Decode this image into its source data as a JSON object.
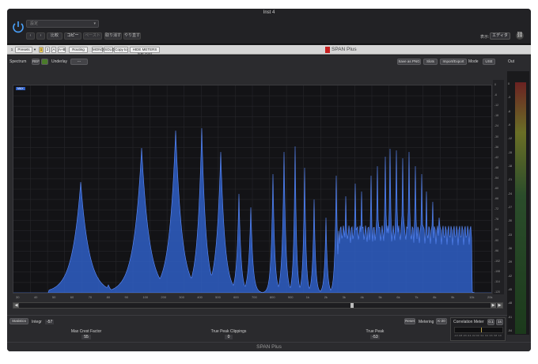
{
  "host": {
    "title": "Inst 4",
    "preset_placeholder": "設定",
    "buttons": [
      "比較",
      "コピー",
      "ペースト",
      "取り消す",
      "やり直す"
    ],
    "right_label": "表示:",
    "right_value": "エディタ",
    "link_icon": "link-icon"
  },
  "plugin_toolbar": {
    "presets_label": "Presets",
    "slots": [
      "1",
      "2",
      "A",
      "A+B"
    ],
    "routing_label": "Routing",
    "mono": "MONO",
    "solo": "SOLO",
    "copy_to": "Copy to",
    "meters": "HIDE METERS (ME DIS)",
    "title": "SPAN Plus"
  },
  "spectrum": {
    "label": "Spectrum",
    "btn_a": "REF",
    "underlay_label": "Underlay",
    "underlay_value": "---",
    "save_png": "Save as PNG",
    "slots": "Slots",
    "import_export": "Import/Export",
    "mode_label": "Mode",
    "mode_value": "USE",
    "out_label": "Out",
    "legend_tag": "MAX",
    "freq_ticks": [
      "30",
      "40",
      "50",
      "60",
      "70",
      "80",
      "90",
      "100",
      "200",
      "300",
      "400",
      "500",
      "600",
      "700",
      "800",
      "900",
      "1k",
      "2k",
      "3k",
      "4k",
      "5k",
      "6k",
      "7k",
      "8k",
      "9k",
      "10k",
      "20k"
    ],
    "db_ticks": [
      "0",
      "-6",
      "-12",
      "-18",
      "-24",
      "-30",
      "-36",
      "-42",
      "-48",
      "-54",
      "-60",
      "-66",
      "-72",
      "-78",
      "-84",
      "-90",
      "-96",
      "-102",
      "-108",
      "-114",
      "-120"
    ],
    "out_ticks": [
      "0",
      "-3",
      "-6",
      "-9",
      "-12",
      "-15",
      "-18",
      "-21",
      "-24",
      "-27",
      "-30",
      "-33",
      "-36",
      "-39",
      "-42",
      "-45",
      "-48",
      "-51",
      "-54"
    ],
    "fill_color": "#2f5fc6",
    "line_color": "#5b8cff"
  },
  "stats": {
    "label": "Statistics",
    "integr_label": "Integr",
    "integr_value": "-57",
    "max_crest_label": "Max Crest Factor",
    "max_crest_value": "55",
    "tp_clip_label": "True Peak Clippings",
    "tp_clip_value": "0",
    "true_peak_label": "True Peak",
    "true_peak_value": "-53",
    "reset": "Reset",
    "metering_label": "Metering",
    "metering_value": "K-20"
  },
  "correlation": {
    "label": "Correlation Meter",
    "btn1": "0.1",
    "btn2": "1s",
    "scale": [
      "-1.0",
      "-0.8",
      "-0.6",
      "-0.4",
      "-0.2",
      "0.0",
      "0.2",
      "0.4",
      "0.6",
      "0.8",
      "1.0"
    ]
  },
  "footer": {
    "text": "SPAN Plus"
  }
}
